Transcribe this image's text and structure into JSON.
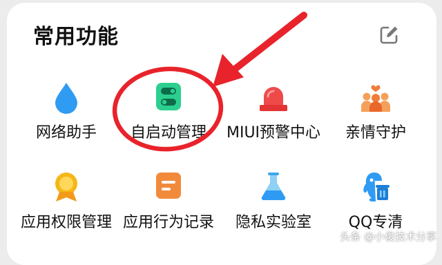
{
  "section": {
    "title": "常用功能",
    "edit_icon": "edit-icon"
  },
  "items": [
    {
      "label": "网络助手",
      "icon": "water-drop-icon"
    },
    {
      "label": "自启动管理",
      "icon": "toggle-switch-icon"
    },
    {
      "label": "MIUI预警中心",
      "icon": "alarm-siren-icon"
    },
    {
      "label": "亲情守护",
      "icon": "family-icon"
    },
    {
      "label": "应用权限管理",
      "icon": "medal-badge-icon"
    },
    {
      "label": "应用行为记录",
      "icon": "record-note-icon"
    },
    {
      "label": "隐私实验室",
      "icon": "lab-flask-icon"
    },
    {
      "label": "QQ专清",
      "icon": "qq-penguin-icon"
    }
  ],
  "colors": {
    "accent_red": "#e8232b",
    "blue": "#2f9bf2",
    "green": "#2ccf8f",
    "orange": "#f28a3c",
    "yellow": "#f5b718"
  },
  "watermark": "头条 @小俊技术分享"
}
